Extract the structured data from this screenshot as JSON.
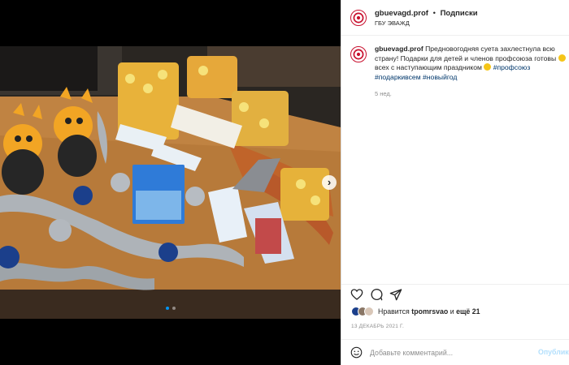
{
  "post": {
    "username": "gbuevagd.prof",
    "header_separator": "•",
    "follow_label": "Подписки",
    "subtitle": "ГБУ ЭВАЖД",
    "caption_parts": {
      "text": "Предновогодняя суета захлестнула всю страну! Подарки для детей и членов профсоюза готовы ",
      "text2": " всех с наступающим праздником ",
      "tag1": "#профсоюз",
      "tag2": "#подаркивсем",
      "tag3": "#новыйгод"
    },
    "caption_time": "5 нед.",
    "likes": {
      "prefix": "Нравится",
      "user": "tpomrsvao",
      "middle": "и",
      "rest": "ещё 21"
    },
    "date": "13 ДЕКАБРЬ 2021 Г.",
    "comment_placeholder": "Добавьте комментарий...",
    "publish_label": "Опубликовать"
  },
  "carousel": {
    "total": 2,
    "current": 1
  },
  "colors": {
    "accent": "#0095f6",
    "brand": "#c8102e",
    "publish_disabled": "#b2dffc"
  },
  "icons": [
    "heart-icon",
    "comment-icon",
    "share-icon",
    "smile-icon",
    "chevron-right-icon",
    "logo-icon"
  ]
}
